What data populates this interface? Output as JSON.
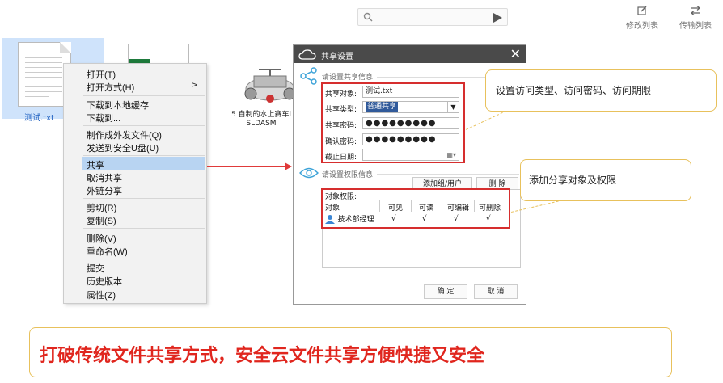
{
  "toolbar": {
    "edit_list": "修改列表",
    "transfer_list": "传输列表"
  },
  "files": {
    "selected_name": "测试.txt",
    "cad_name_line1": "5 自制的水上赛车i",
    "cad_name_line2": "SLDASM"
  },
  "context_menu": {
    "items": [
      {
        "label": "打开(T)"
      },
      {
        "label": "打开方式(H)"
      },
      {
        "label": "下载到本地缓存"
      },
      {
        "label": "下载到..."
      },
      {
        "label": "制作成外发文件(Q)"
      },
      {
        "label": "发送到安全U盘(U)"
      },
      {
        "label": "共享"
      },
      {
        "label": "取消共享"
      },
      {
        "label": "外链分享"
      },
      {
        "label": "剪切(R)"
      },
      {
        "label": "复制(S)"
      },
      {
        "label": "删除(V)"
      },
      {
        "label": "重命名(W)"
      },
      {
        "label": "提交"
      },
      {
        "label": "历史版本"
      },
      {
        "label": "属性(Z)"
      }
    ],
    "submenu_arrow": ">"
  },
  "dialog": {
    "title": "共享设置",
    "share_info_title": "请设置共享信息",
    "share_object_label": "共享对象:",
    "share_object_value": "测试.txt",
    "share_type_label": "共享类型:",
    "share_type_value": "普通共享",
    "password_label": "共享密码:",
    "password_value": "●●●●●●●●●",
    "confirm_label": "确认密码:",
    "confirm_value": "●●●●●●●●●",
    "expiry_label": "截止日期:",
    "perm_title": "请设置权限信息",
    "add_button": "添加组/用户",
    "delete_button": "删 除",
    "object_perm_label": "对象权限:",
    "columns": [
      "对象",
      "可见",
      "可读",
      "可编辑",
      "可删除"
    ],
    "row": {
      "name": "技术部经理",
      "visible": "√",
      "read": "√",
      "edit": "√",
      "delete": "√"
    },
    "ok_button": "确 定",
    "cancel_button": "取 消"
  },
  "callouts": {
    "top": "设置访问类型、访问密码、访问期限",
    "bottom": "添加分享对象及权限"
  },
  "slogan": "打破传统文件共享方式，安全云文件共享方便快捷又安全",
  "colors": {
    "accent_red": "#d62e2e",
    "slogan_red": "#e0261e",
    "callout_border": "#e8c15c",
    "selection_blue": "#b8d4f2"
  }
}
